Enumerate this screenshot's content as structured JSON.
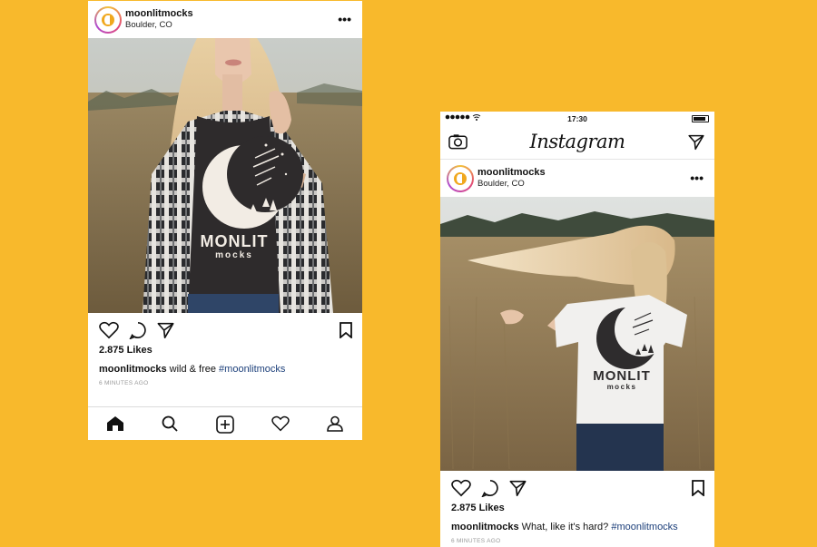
{
  "background_color": "#f8b92c",
  "post1": {
    "username": "moonlitmocks",
    "location": "Boulder, CO",
    "more": "•••",
    "shirt_brand_line1": "MONLIT",
    "shirt_brand_line2": "mocks",
    "likes": "2.875 Likes",
    "caption_user": "moonlitmocks",
    "caption_text": " wild & free ",
    "caption_tag": "#moonlitmocks",
    "timestamp": "6 MINUTES AGO",
    "icons": [
      "heart-icon",
      "comment-icon",
      "share-icon",
      "bookmark-icon"
    ],
    "tabbar": [
      "home-icon",
      "search-icon",
      "add-post-icon",
      "activity-heart-icon",
      "profile-icon"
    ]
  },
  "post2": {
    "status_time": "17:30",
    "app_name": "Instagram",
    "appbar_icons": [
      "camera-icon",
      "direct-message-icon"
    ],
    "username": "moonlitmocks",
    "location": "Boulder, CO",
    "more": "•••",
    "shirt_brand_line1": "MONLIT",
    "shirt_brand_line2": "mocks",
    "likes": "2.875 Likes",
    "caption_user": "moonlitmocks",
    "caption_text": " What, like it's hard? ",
    "caption_tag": "#moonlitmocks",
    "timestamp": "6 MINUTES AGO",
    "icons": [
      "heart-icon",
      "comment-icon",
      "share-icon",
      "bookmark-icon"
    ]
  }
}
